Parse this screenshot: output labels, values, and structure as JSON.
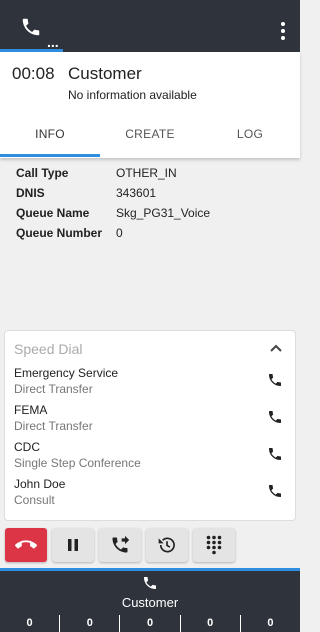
{
  "top_bar": {
    "dots": "..."
  },
  "call": {
    "timer": "00:08",
    "caller_name": "Customer",
    "caller_info": "No information available"
  },
  "tabs": {
    "info": "INFO",
    "create": "CREATE",
    "log": "LOG",
    "active": "INFO"
  },
  "info": {
    "rows": [
      {
        "key": "Call Type",
        "value": "OTHER_IN"
      },
      {
        "key": "DNIS",
        "value": "343601"
      },
      {
        "key": "Queue Name",
        "value": "Skg_PG31_Voice"
      },
      {
        "key": "Queue Number",
        "value": "0"
      }
    ]
  },
  "speed_dial": {
    "title": "Speed Dial",
    "items": [
      {
        "name": "Emergency Service",
        "type": "Direct Transfer"
      },
      {
        "name": "FEMA",
        "type": "Direct Transfer"
      },
      {
        "name": "CDC",
        "type": "Single Step Conference"
      },
      {
        "name": "John Doe",
        "type": "Consult"
      }
    ]
  },
  "bottom_bar": {
    "label": "Customer",
    "counts": [
      "0",
      "0",
      "0",
      "0",
      "0"
    ]
  },
  "colors": {
    "bar_bg": "#2e333c",
    "accent": "#2f8ee0",
    "end_call": "#dc3545"
  },
  "icons": {
    "top_phone": "phone-icon",
    "menu": "more-vert-icon",
    "collapse": "chevron-up-icon",
    "speed_dial_call": "phone-icon",
    "end_call": "call-end-icon",
    "hold": "pause-icon",
    "transfer": "phone-forward-icon",
    "history": "history-icon",
    "keypad": "dialpad-icon"
  }
}
